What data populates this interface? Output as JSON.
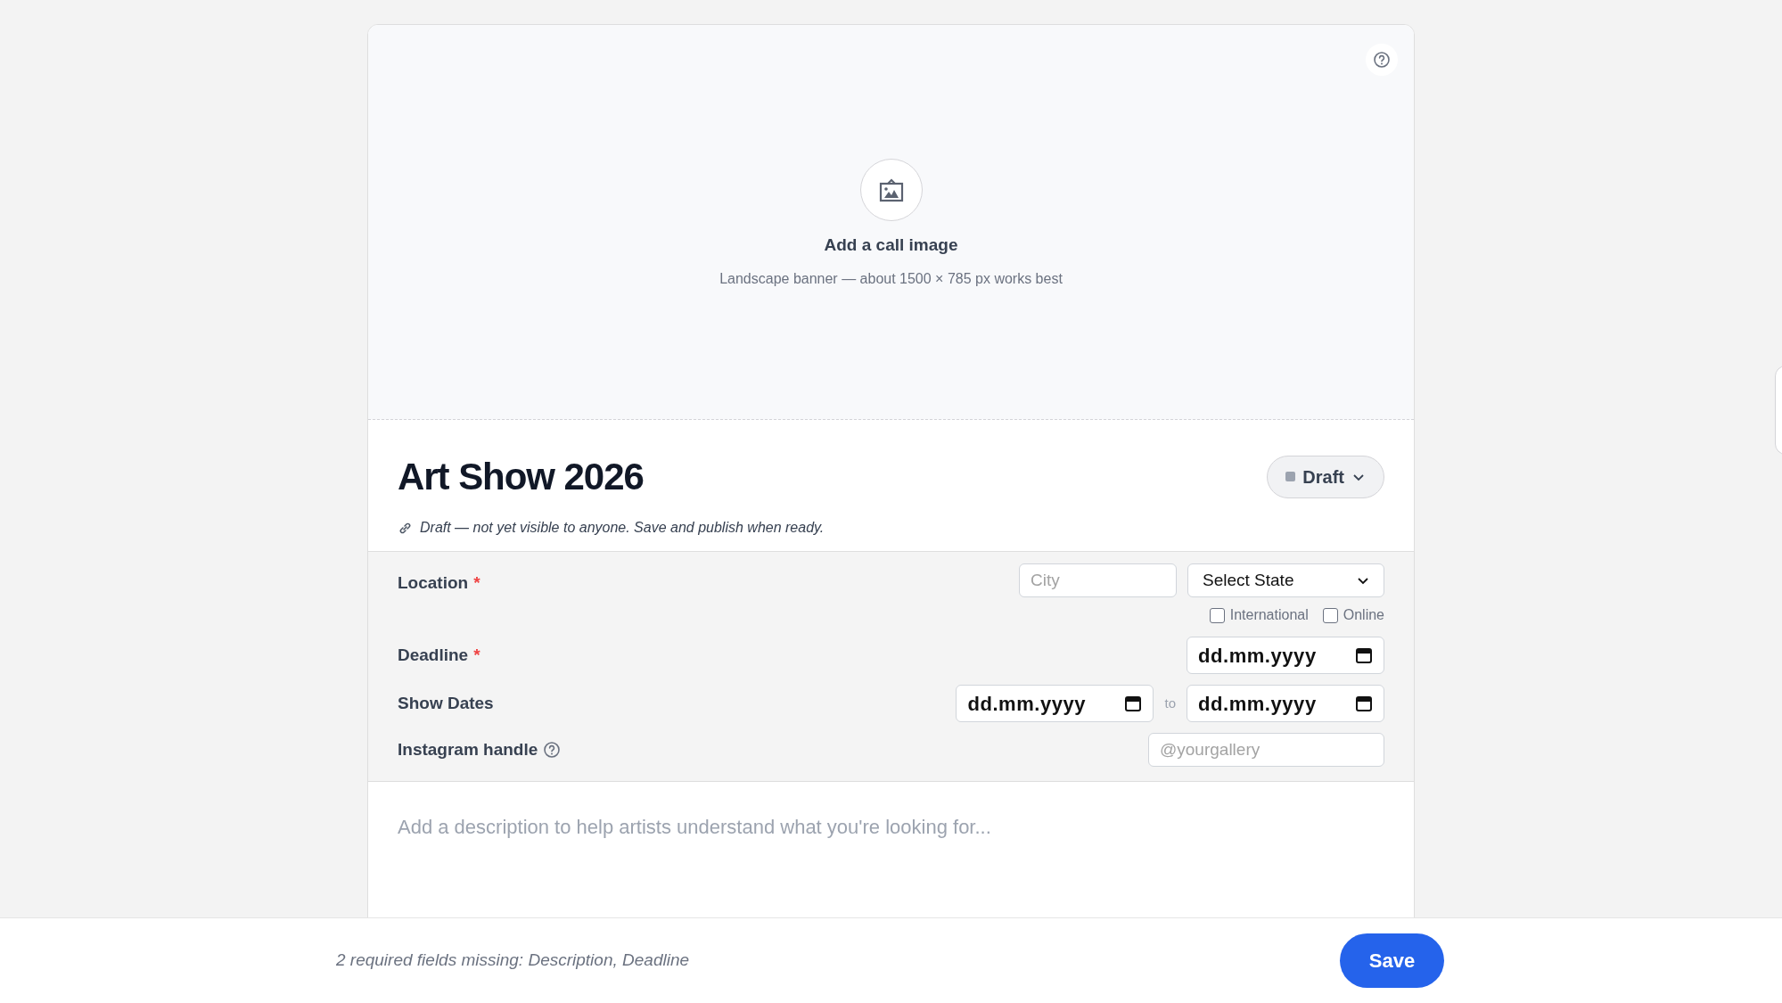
{
  "banner": {
    "title": "Add a call image",
    "hint": "Landscape banner — about 1500 × 785 px works best"
  },
  "call": {
    "title": "Art Show 2026",
    "status": "Draft",
    "note": "Draft — not yet visible to anyone. Save and publish when ready."
  },
  "fields": [
    {
      "kind": "location",
      "label": "Location",
      "required_mark": "*",
      "city_placeholder": "City",
      "state_select": "Select State",
      "options": [
        {
          "label": "International",
          "checked": false
        },
        {
          "label": "Online",
          "checked": false
        }
      ]
    },
    {
      "kind": "date",
      "label": "Deadline",
      "required_mark": "*",
      "value": "dd.mm.yyyy"
    },
    {
      "kind": "range",
      "label": "Show Dates",
      "from": "dd.mm.yyyy",
      "separator": "to",
      "to": "dd.mm.yyyy"
    },
    {
      "kind": "text",
      "label": "Instagram handle",
      "has_help": true,
      "placeholder": "@yourgallery"
    }
  ],
  "description": {
    "placeholder": "Add a description to help artists understand what you're looking for..."
  },
  "footer": {
    "message": "2 required fields missing: Description, Deadline",
    "save": "Save"
  }
}
